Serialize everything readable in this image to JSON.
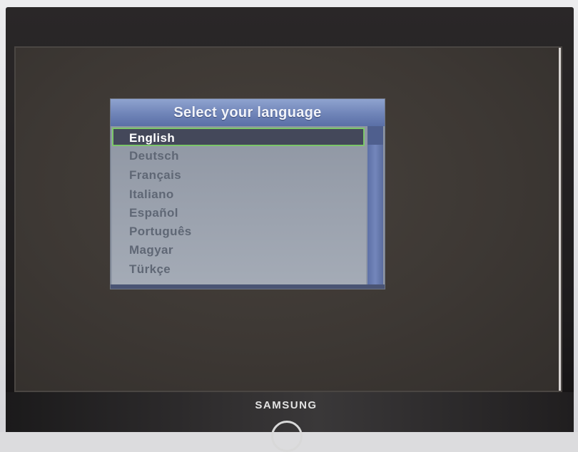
{
  "dialog": {
    "title": "Select your language",
    "languages": [
      {
        "label": "English",
        "selected": true
      },
      {
        "label": "Deutsch",
        "selected": false
      },
      {
        "label": "Français",
        "selected": false
      },
      {
        "label": "Italiano",
        "selected": false
      },
      {
        "label": "Español",
        "selected": false
      },
      {
        "label": "Português",
        "selected": false
      },
      {
        "label": "Magyar",
        "selected": false
      },
      {
        "label": "Türkçe",
        "selected": false
      }
    ]
  },
  "monitor": {
    "brand": "SAMSUNG"
  },
  "colors": {
    "title_bar": "#6f84b8",
    "list_background": "#9aa1ad",
    "selection_background": "#44485a",
    "selection_border": "#7cc76a",
    "unselected_text": "#5f6775",
    "scrollbar": "#6a7db2",
    "screen_background": "#3f3a36"
  }
}
